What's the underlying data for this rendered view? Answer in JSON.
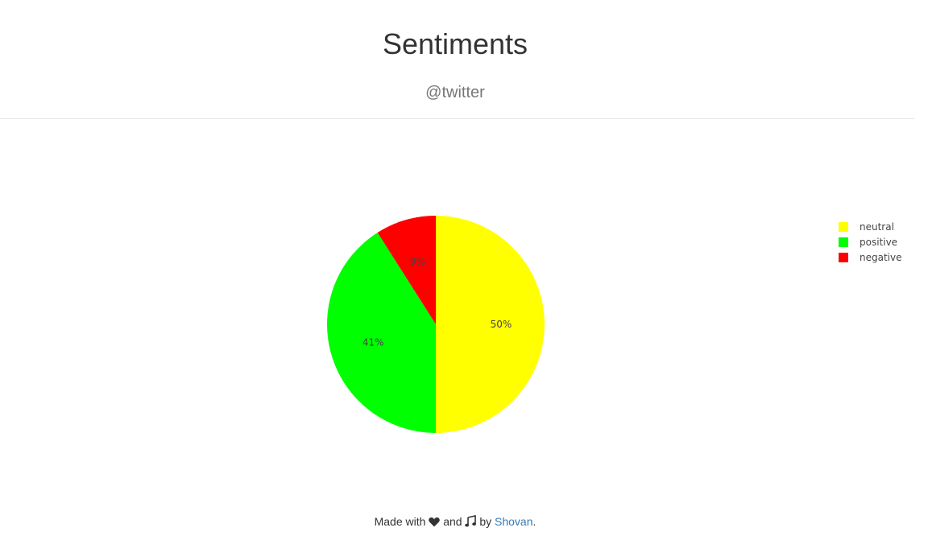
{
  "header": {
    "title": "Sentiments",
    "subtitle": "@twitter"
  },
  "chart_data": {
    "type": "pie",
    "categories": [
      "neutral",
      "positive",
      "negative"
    ],
    "values": [
      50,
      41,
      9
    ],
    "labels": [
      "50%",
      "41%",
      "9%"
    ],
    "colors": [
      "#ffff00",
      "#00ff00",
      "#ff0000"
    ],
    "legend": [
      "neutral",
      "positive",
      "negative"
    ],
    "legend_position": "right"
  },
  "footer": {
    "prefix": "Made with",
    "and_text": "and",
    "by_text": "by",
    "author": "Shovan",
    "suffix": "."
  },
  "icons": {
    "heart": "heart-icon",
    "music": "music-note-icon"
  }
}
